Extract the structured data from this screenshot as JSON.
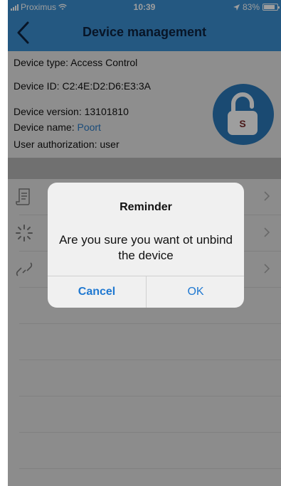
{
  "status_bar": {
    "carrier": "Proximus",
    "time": "10:39",
    "battery": "83%",
    "battery_level": 0.83
  },
  "nav": {
    "title": "Device management",
    "back_icon": "chevron-left-icon"
  },
  "device_info": {
    "type_label": "Device type: Access Control",
    "id_label": "Device ID: C2:4E:D2:D6:E3:3A",
    "version_label": "Device version: 13101810",
    "name_prefix": "Device name: ",
    "name_value": "Poort",
    "auth_label": "User authorization: user"
  },
  "lock_badge": {
    "icon": "padlock-icon",
    "letter": "S"
  },
  "list_items": [
    {
      "icon": "document-icon"
    },
    {
      "icon": "loading-spinner-icon"
    },
    {
      "icon": "unlink-icon"
    }
  ],
  "dialog": {
    "title": "Reminder",
    "message": "Are you sure you want ot unbind the device",
    "cancel_label": "Cancel",
    "ok_label": "OK"
  },
  "colors": {
    "header": "#3b8fd0",
    "accent": "#1f78d1",
    "lock_badge": "#2a78b8"
  }
}
